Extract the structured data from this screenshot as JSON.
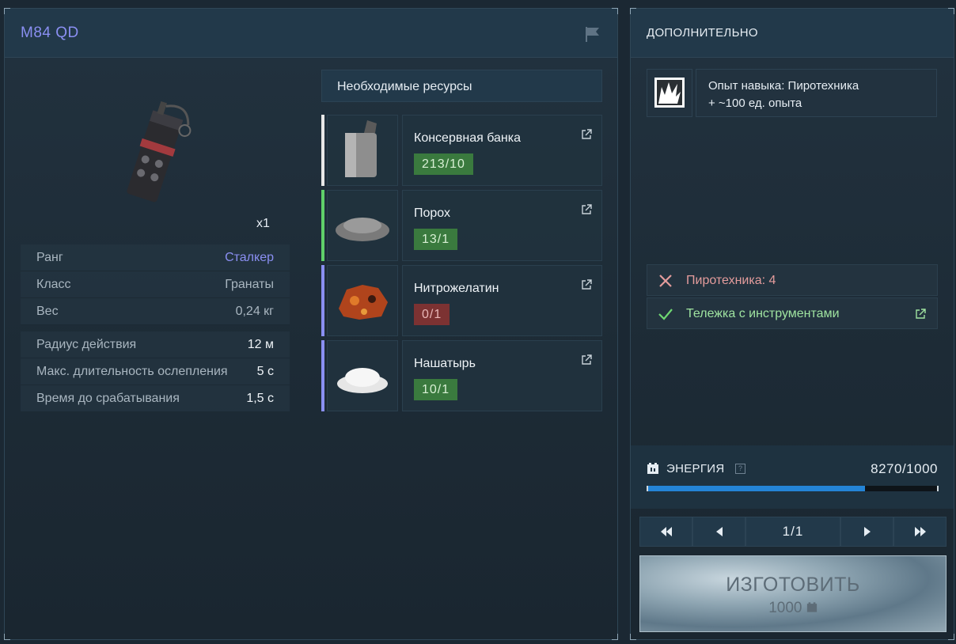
{
  "item": {
    "title": "M84 QD",
    "quantity": "x1"
  },
  "stats": {
    "primary": [
      {
        "label": "Ранг",
        "value": "Сталкер"
      },
      {
        "label": "Класс",
        "value": "Гранаты"
      },
      {
        "label": "Вес",
        "value": "0,24 кг"
      }
    ],
    "secondary": [
      {
        "label": "Радиус действия",
        "value": "12 м"
      },
      {
        "label": "Макс. длительность ослепления",
        "value": "5 с"
      },
      {
        "label": "Время до срабатывания",
        "value": "1,5 с"
      }
    ]
  },
  "resources": {
    "header": "Необходимые ресурсы",
    "items": [
      {
        "name": "Консервная банка",
        "count": "213/10",
        "status": "ok",
        "bar_color": "#e8e8e8"
      },
      {
        "name": "Порох",
        "count": "13/1",
        "status": "ok",
        "bar_color": "#5fd06a"
      },
      {
        "name": "Нитрожелатин",
        "count": "0/1",
        "status": "missing",
        "bar_color": "#8a8ff2"
      },
      {
        "name": "Нашатырь",
        "count": "10/1",
        "status": "ok",
        "bar_color": "#8a8ff2"
      }
    ]
  },
  "extra": {
    "title": "ДОПОЛНИТЕЛЬНО",
    "skill_line1": "Опыт навыка: Пиротехника",
    "skill_line2": "+ ~100 ед. опыта",
    "requirements": [
      {
        "label": "Пиротехника: 4",
        "met": false,
        "icon": "cross-icon"
      },
      {
        "label": "Тележка с инструментами",
        "met": true,
        "icon": "check-icon"
      }
    ]
  },
  "energy": {
    "label": "ЭНЕРГИЯ",
    "help": "?",
    "value": "8270/1000",
    "fill_fraction": 0.75
  },
  "pager": {
    "label": "1/1"
  },
  "craft": {
    "label": "ИЗГОТОВИТЬ",
    "cost": "1000"
  },
  "colors": {
    "accent_purple": "#8a8ff2",
    "ok_green": "#3a7a3e",
    "bad_red": "#7c3232",
    "energy_blue": "#2484d6"
  }
}
